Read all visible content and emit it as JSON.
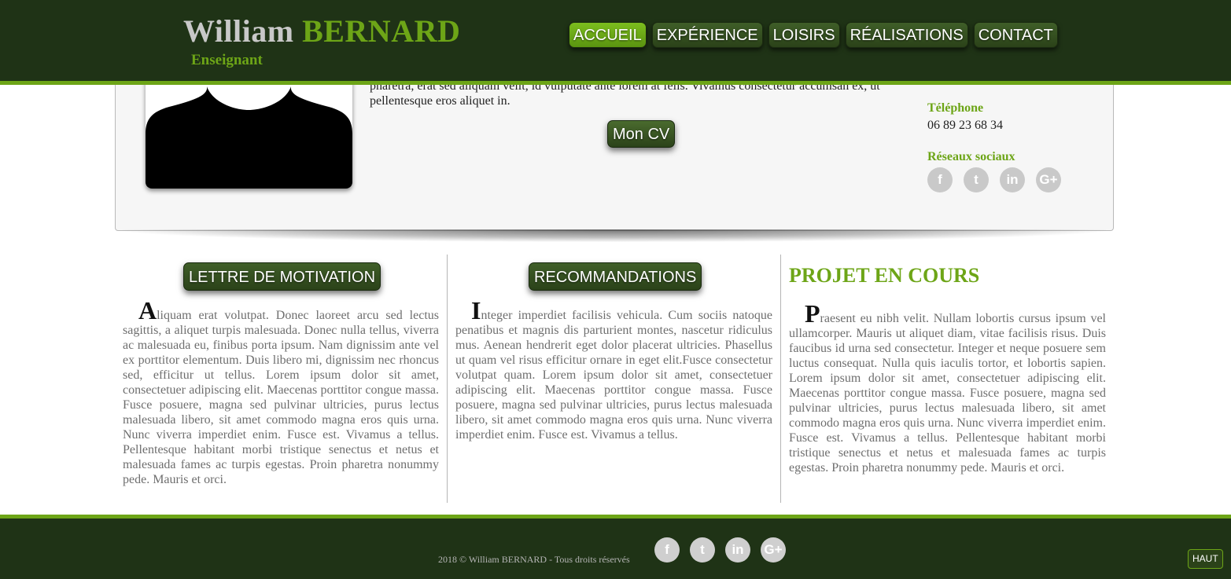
{
  "header": {
    "first_name": "William",
    "last_name": "BERNARD",
    "subtitle": "Enseignant",
    "nav": [
      "ACCUEIL",
      "EXPÉRIENCE",
      "LOISIRS",
      "RÉALISATIONS",
      "CONTACT"
    ],
    "active_nav": "ACCUEIL"
  },
  "profile": {
    "bio_partial_line": "pharetra, erat sed aliquam velit, id vulputate ante lorem at felis. Vivamus consectetur accumsan ex, ut",
    "bio_last_line": "pellentesque eros aliquet in.",
    "cv_button": "Mon CV",
    "phone_label": "Téléphone",
    "phone": "06 89 23 68 34",
    "social_label": "Réseaux sociaux",
    "social_icons": [
      "facebook-icon",
      "twitter-icon",
      "linkedin-icon",
      "google-plus-icon"
    ]
  },
  "columns": {
    "motivation": {
      "button": "LETTRE DE MOTIVATION",
      "drop_cap": "A",
      "text": "liquam erat volutpat. Donec laoreet arcu sed lectus sagittis, a aliquet turpis malesuada. Donec nulla tellus, viverra ac malesuada eu, finibus porta ipsum. Nam dignissim ante vel ex porttitor elementum. Duis libero mi, dignissim nec rhoncus sed, efficitur ut tellus. Lorem ipsum dolor sit amet, consectetuer adipiscing elit. Maecenas porttitor congue massa. Fusce posuere, magna sed pulvinar ultricies, purus lectus malesuada libero, sit amet commodo magna eros quis urna. Nunc viverra imperdiet enim. Fusce est. Vivamus a tellus. Pellentesque habitant morbi tristique senectus et netus et malesuada fames ac turpis egestas. Proin pharetra nonummy pede. Mauris et orci."
    },
    "recommandations": {
      "button": "RECOMMANDATIONS",
      "drop_cap": "I",
      "text": "nteger imperdiet facilisis vehicula. Cum sociis natoque penatibus et magnis dis parturient montes, nascetur ridiculus mus. Aenean hendrerit eget dolor placerat ultricies. Phasellus ut quam vel risus efficitur ornare in eget elit.Fusce consectetur volutpat quam. Lorem ipsum dolor sit amet, consectetuer adipiscing elit. Maecenas porttitor congue massa. Fusce posuere, magna sed pulvinar ultricies, purus lectus malesuada libero, sit amet commodo magna eros quis urna. Nunc viverra imperdiet enim. Fusce est. Vivamus a tellus."
    },
    "projet": {
      "title": "PROJET EN COURS",
      "drop_cap": "P",
      "text": "raesent eu nibh velit. Nullam lobortis cursus ipsum vel ullamcorper. Mauris ut aliquet diam, vitae facilisis risus. Duis faucibus id urna sed consectetur. Integer et neque posuere sem luctus consequat. Nulla quis iaculis tortor, et lobortis sapien. Lorem ipsum dolor sit amet, consectetuer adipiscing elit. Maecenas porttitor congue massa. Fusce posuere, magna sed pulvinar ultricies, purus lectus malesuada libero, sit amet commodo magna eros quis urna. Nunc viverra imperdiet enim. Fusce est. Vivamus a tellus. Pellentesque habitant morbi tristique senectus et netus et malesuada fames ac turpis egestas. Proin pharetra nonummy pede. Mauris et orci."
    }
  },
  "footer": {
    "copyright": "2018 © William BERNARD - Tous droits réservés",
    "top_button": "HAUT"
  },
  "colors": {
    "accent": "#6da517",
    "dark": "#1f3316"
  }
}
